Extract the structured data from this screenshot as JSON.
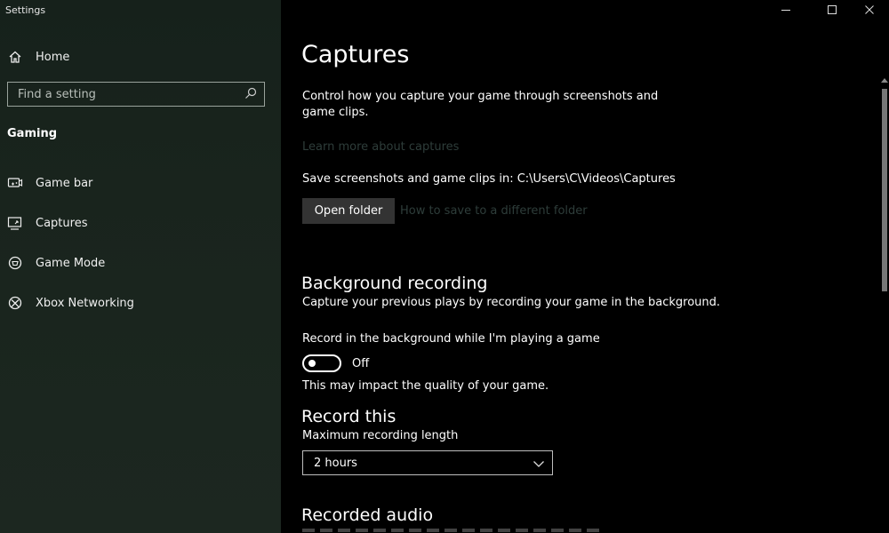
{
  "window": {
    "title": "Settings"
  },
  "sidebar": {
    "home_label": "Home",
    "search_placeholder": "Find a setting",
    "section_label": "Gaming",
    "items": [
      {
        "label": "Game bar",
        "icon": "game-bar-icon"
      },
      {
        "label": "Captures",
        "icon": "captures-icon"
      },
      {
        "label": "Game Mode",
        "icon": "game-mode-icon"
      },
      {
        "label": "Xbox Networking",
        "icon": "xbox-icon"
      }
    ]
  },
  "main": {
    "title": "Captures",
    "description": "Control how you capture your game through screenshots and game clips.",
    "learn_more_link": "Learn more about captures",
    "save_path_text": "Save screenshots and game clips in: C:\\Users\\C\\Videos\\Captures",
    "open_folder_label": "Open folder",
    "how_to_link": "How to save to a different folder",
    "background_recording": {
      "title": "Background recording",
      "subtitle": "Capture your previous plays by recording your game in the background.",
      "toggle_label": "Record in the background while I'm playing a game",
      "toggle_state": "Off",
      "note": "This may impact the quality of your game."
    },
    "record_this": {
      "title": "Record this",
      "max_length_label": "Maximum recording length",
      "max_length_value": "2 hours"
    },
    "recorded_audio": {
      "title": "Recorded audio"
    }
  },
  "colors": {
    "sidebar_bg": "#19241d",
    "content_bg": "#000000",
    "dim_link": "#2e3d3a",
    "button_bg": "#333333"
  }
}
